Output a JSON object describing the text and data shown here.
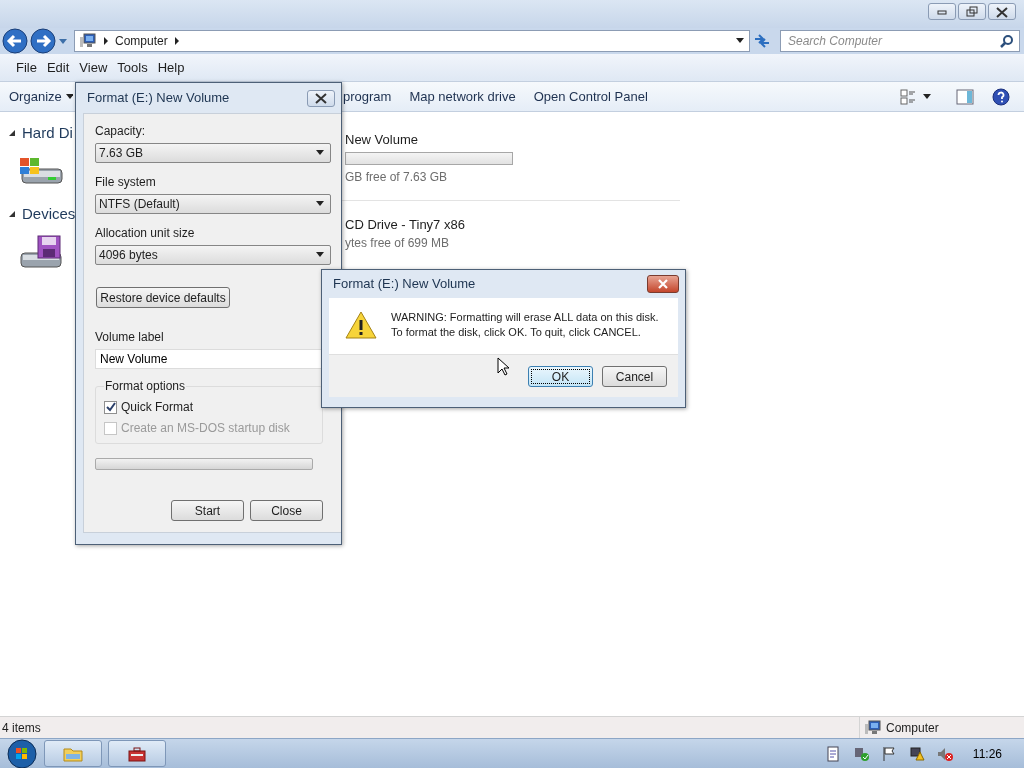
{
  "address_bar": {
    "crumbs": [
      "Computer"
    ]
  },
  "search": {
    "placeholder": "Search Computer"
  },
  "menu": [
    "File",
    "Edit",
    "View",
    "Tools",
    "Help"
  ],
  "command_bar": {
    "items": [
      "Organize",
      "program",
      "Map network drive",
      "Open Control Panel"
    ]
  },
  "groups": [
    "Hard Di",
    "Devices"
  ],
  "drives": [
    {
      "kind": "bar",
      "name": "New Volume",
      "detail": "GB free of 7.63 GB"
    },
    {
      "kind": "plain",
      "name": "CD Drive - Tiny7 x86",
      "detail": "ytes free of 699 MB"
    }
  ],
  "status_bar": {
    "count": "4 items",
    "location": "Computer"
  },
  "taskbar": {
    "clock": "11:26"
  },
  "format_dialog": {
    "title": "Format (E:) New Volume",
    "fields": [
      {
        "label": "Capacity:",
        "value": "7.63 GB"
      },
      {
        "label": "File system",
        "value": "NTFS (Default)"
      },
      {
        "label": "Allocation unit size",
        "value": "4096 bytes"
      }
    ],
    "restore_button": "Restore device defaults",
    "volume_label": {
      "label": "Volume label",
      "value": "New Volume"
    },
    "options_title": "Format options",
    "options": [
      {
        "label": "Quick Format",
        "checked": true,
        "disabled": false
      },
      {
        "label": "Create an MS-DOS startup disk",
        "checked": false,
        "disabled": true
      }
    ],
    "progress": {
      "level": 0
    },
    "buttons": [
      "Start",
      "Close"
    ]
  },
  "warning_dialog": {
    "title": "Format (E:) New Volume",
    "message": [
      "WARNING: Formatting will erase ALL data on this disk.",
      "To format the disk, click OK. To quit, click CANCEL."
    ],
    "buttons": [
      {
        "label": "OK",
        "selected": true
      },
      {
        "label": "Cancel",
        "selected": false
      }
    ]
  }
}
